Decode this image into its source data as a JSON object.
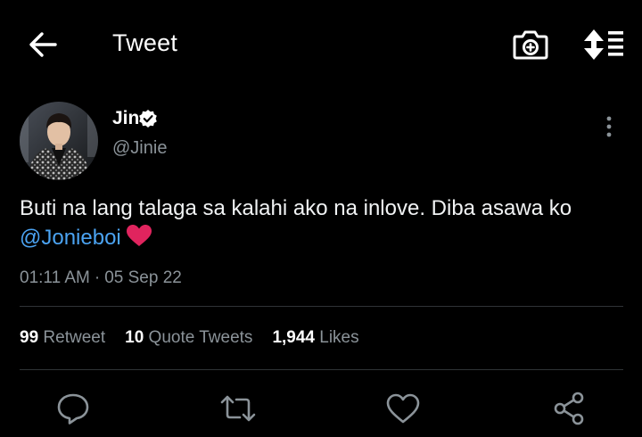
{
  "header": {
    "title": "Tweet",
    "back_icon": "back-arrow-icon",
    "camera_icon": "add-photo-icon",
    "sort_icon": "sort-icon"
  },
  "author": {
    "name": "Jin",
    "handle": "@Jinie",
    "verified": true
  },
  "tweet": {
    "text": "Buti na lang talaga sa kalahi ako na inlove. Diba asawa ko",
    "mention": "@Jonieboi",
    "emoji": "red-heart",
    "time": "01:11 AM",
    "separator": "·",
    "date": "05 Sep 22"
  },
  "stats": {
    "retweets_count": "99",
    "retweets_label": "Retweet",
    "quotes_count": "10",
    "quotes_label": "Quote Tweets",
    "likes_count": "1,944",
    "likes_label": "Likes"
  },
  "actions": [
    "reply-icon",
    "retweet-icon",
    "like-icon",
    "share-icon"
  ],
  "colors": {
    "background": "#000000",
    "text": "#f1f3f4",
    "secondary": "#8b9399",
    "mention": "#4ba3f2",
    "divider": "#2f3336",
    "heart": "#e0245e"
  }
}
